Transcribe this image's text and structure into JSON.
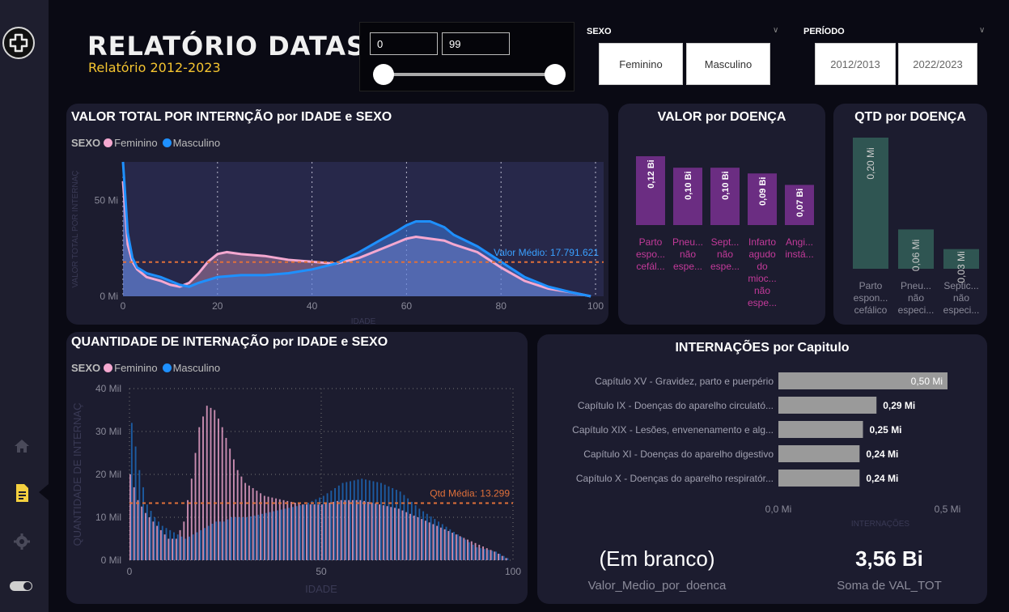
{
  "header": {
    "title": "RELATÓRIO DATASUS",
    "subtitle": "Relatório 2012-2023"
  },
  "age_slicer": {
    "min_value": "0",
    "max_value": "99"
  },
  "sexo_slicer": {
    "label": "SEXO",
    "options": [
      "Feminino",
      "Masculino"
    ]
  },
  "periodo_slicer": {
    "label": "PERÍODO",
    "options": [
      "2012/2013",
      "2022/2023"
    ]
  },
  "colors": {
    "feminino": "#f4a8d0",
    "masculino": "#1e90ff",
    "avg_line": "#e0703a",
    "purple_bar": "#6b2d82",
    "teal_bar": "#2f5552",
    "grey_bar": "#9a9a9a"
  },
  "sidebar": {
    "icons": [
      "home-icon",
      "report-icon",
      "gear-icon",
      "toggle-icon"
    ]
  },
  "charts": {
    "valor_total": {
      "title": "VALOR TOTAL POR INTERNÇÃO por IDADE e SEXO",
      "legend_title": "SEXO",
      "legend": [
        "Feminino",
        "Masculino"
      ],
      "ylabel": "VALOR TOTAL POR INTERNAÇ",
      "xlabel": "IDADE",
      "y_ticks": [
        "0 Mi",
        "50 Mi"
      ],
      "x_ticks": [
        "0",
        "20",
        "40",
        "60",
        "80",
        "100"
      ],
      "avg_label": "Valor Médio: 17.791.621"
    },
    "valor_doenca": {
      "title": "VALOR por DOENÇA",
      "labels": [
        "0,12 Bi",
        "0,10 Bi",
        "0,10 Bi",
        "0,09 Bi",
        "0,07 Bi"
      ],
      "categories": [
        [
          "Parto",
          "espo...",
          "cefál..."
        ],
        [
          "Pneu...",
          "não",
          "espe..."
        ],
        [
          "Sept...",
          "não",
          "espe..."
        ],
        [
          "Infarto",
          "agudo",
          "do",
          "mioc...",
          "não",
          "espe..."
        ],
        [
          "Angi...",
          "instá..."
        ]
      ]
    },
    "qtd_doenca": {
      "title": "QTD por DOENÇA",
      "labels": [
        "0,20 Mi",
        "0,06 Mi",
        "0,03 Mi"
      ],
      "categories": [
        [
          "Parto",
          "espon...",
          "cefálico"
        ],
        [
          "Pneu...",
          "não",
          "especi..."
        ],
        [
          "Septic...",
          "não",
          "especi..."
        ]
      ]
    },
    "quantidade": {
      "title": "QUANTIDADE DE INTERNAÇÃO por IDADE e SEXO",
      "legend_title": "SEXO",
      "legend": [
        "Feminino",
        "Masculino"
      ],
      "ylabel": "QUANTIDADE DE INTERNAÇ",
      "xlabel": "IDADE",
      "y_ticks": [
        "0 Mil",
        "10 Mil",
        "20 Mil",
        "30 Mil",
        "40 Mil"
      ],
      "x_ticks": [
        "0",
        "50",
        "100"
      ],
      "avg_label": "Qtd Média: 13.299"
    },
    "capitulo": {
      "title": "INTERNAÇÕES por Capitulo",
      "categories": [
        "Capítulo XV - Gravidez, parto e puerpério",
        "Capítulo IX - Doenças do aparelho circulató...",
        "Capítulo XIX - Lesões, envenenamento e alg...",
        "Capítulo XI - Doenças do aparelho digestivo",
        "Capítulo X - Doenças do aparelho respiratór..."
      ],
      "labels": [
        "0,50 Mi",
        "0,29 Mi",
        "0,25 Mi",
        "0,24 Mi",
        "0,24 Mi"
      ],
      "x_ticks": [
        "0,0 Mi",
        "0,5 Mi"
      ],
      "xlabel": "INTERNAÇÕES"
    }
  },
  "chart_data": [
    {
      "type": "area",
      "title": "VALOR TOTAL POR INTERNÇÃO por IDADE e SEXO",
      "xlabel": "IDADE",
      "ylabel": "VALOR TOTAL POR INTERNAÇ",
      "xlim": [
        0,
        100
      ],
      "ylim": [
        0,
        70
      ],
      "average": 17.791621,
      "series": [
        {
          "name": "Masculino",
          "x": [
            0,
            1,
            2,
            3,
            5,
            8,
            10,
            12,
            14,
            16,
            20,
            25,
            30,
            35,
            40,
            45,
            50,
            55,
            58,
            60,
            62,
            65,
            68,
            70,
            75,
            80,
            85,
            90,
            95,
            99
          ],
          "values": [
            70,
            33,
            20,
            15,
            12,
            10,
            8,
            6,
            5,
            7,
            10,
            11,
            11,
            12,
            14,
            17,
            23,
            30,
            34,
            37,
            39,
            39,
            36,
            32,
            26,
            18,
            10,
            5,
            2,
            0
          ]
        },
        {
          "name": "Feminino",
          "x": [
            0,
            1,
            2,
            3,
            5,
            8,
            10,
            12,
            14,
            16,
            18,
            20,
            22,
            25,
            30,
            35,
            40,
            45,
            50,
            55,
            58,
            60,
            62,
            65,
            68,
            70,
            75,
            80,
            85,
            90,
            95,
            99
          ],
          "values": [
            60,
            27,
            18,
            14,
            10,
            8,
            6,
            5,
            7,
            12,
            18,
            22,
            23,
            22,
            21,
            19,
            18,
            17,
            20,
            25,
            28,
            30,
            31,
            30,
            29,
            27,
            23,
            15,
            8,
            4,
            2,
            0
          ]
        }
      ]
    },
    {
      "type": "bar",
      "title": "VALOR por DOENÇA",
      "categories": [
        "Parto espo... cefál...",
        "Pneu... não espe...",
        "Sept... não espe...",
        "Infarto agudo do mioc... não espe...",
        "Angi... instá..."
      ],
      "values": [
        0.12,
        0.1,
        0.1,
        0.09,
        0.07
      ],
      "unit": "Bi"
    },
    {
      "type": "bar",
      "title": "QTD por DOENÇA",
      "categories": [
        "Parto espon... cefálico",
        "Pneu... não especi...",
        "Septic... não especi..."
      ],
      "values": [
        0.2,
        0.06,
        0.03
      ],
      "unit": "Mi"
    },
    {
      "type": "bar",
      "title": "QUANTIDADE DE INTERNAÇÃO por IDADE e SEXO",
      "xlabel": "IDADE",
      "ylabel": "QUANTIDADE DE INTERNAÇ",
      "xlim": [
        0,
        100
      ],
      "ylim": [
        0,
        40
      ],
      "average": 13.299,
      "series": [
        {
          "name": "Feminino",
          "x": [
            0,
            2,
            4,
            6,
            8,
            10,
            12,
            14,
            16,
            18,
            20,
            22,
            24,
            26,
            28,
            30,
            35,
            40,
            45,
            50,
            55,
            60,
            65,
            70,
            75,
            80,
            85,
            90,
            95,
            99
          ],
          "values": [
            20,
            14,
            11,
            9,
            7,
            5,
            5,
            9,
            19,
            31,
            36,
            35,
            31,
            26,
            21,
            18,
            15,
            14,
            13,
            13,
            14,
            14,
            13,
            12,
            10,
            8,
            6,
            4,
            2,
            0
          ]
        },
        {
          "name": "Masculino",
          "x": [
            0,
            2,
            4,
            6,
            8,
            10,
            12,
            14,
            16,
            18,
            20,
            22,
            24,
            26,
            28,
            30,
            35,
            40,
            45,
            50,
            55,
            60,
            65,
            70,
            75,
            80,
            85,
            90,
            95,
            99
          ],
          "values": [
            32,
            21,
            13,
            10,
            8,
            7,
            6,
            5,
            6,
            7,
            8,
            9,
            9,
            10,
            10,
            10,
            11,
            12,
            13,
            15,
            18,
            19,
            18,
            16,
            12,
            9,
            6,
            3,
            2,
            0
          ]
        }
      ]
    },
    {
      "type": "bar",
      "title": "INTERNAÇÕES por Capitulo",
      "orientation": "horizontal",
      "categories": [
        "Capítulo XV - Gravidez, parto e puerpério",
        "Capítulo IX - Doenças do aparelho circulató...",
        "Capítulo XIX - Lesões, envenenamento e alg...",
        "Capítulo XI - Doenças do aparelho digestivo",
        "Capítulo X - Doenças do aparelho respiratór..."
      ],
      "values": [
        0.5,
        0.29,
        0.25,
        0.24,
        0.24
      ],
      "xlim": [
        0,
        0.5
      ],
      "xlabel": "INTERNAÇÕES",
      "unit": "Mi"
    }
  ],
  "kpis": [
    {
      "value": "(Em branco)",
      "label": "Valor_Medio_por_doenca"
    },
    {
      "value": "3,56 Bi",
      "label": "Soma de VAL_TOT"
    }
  ]
}
